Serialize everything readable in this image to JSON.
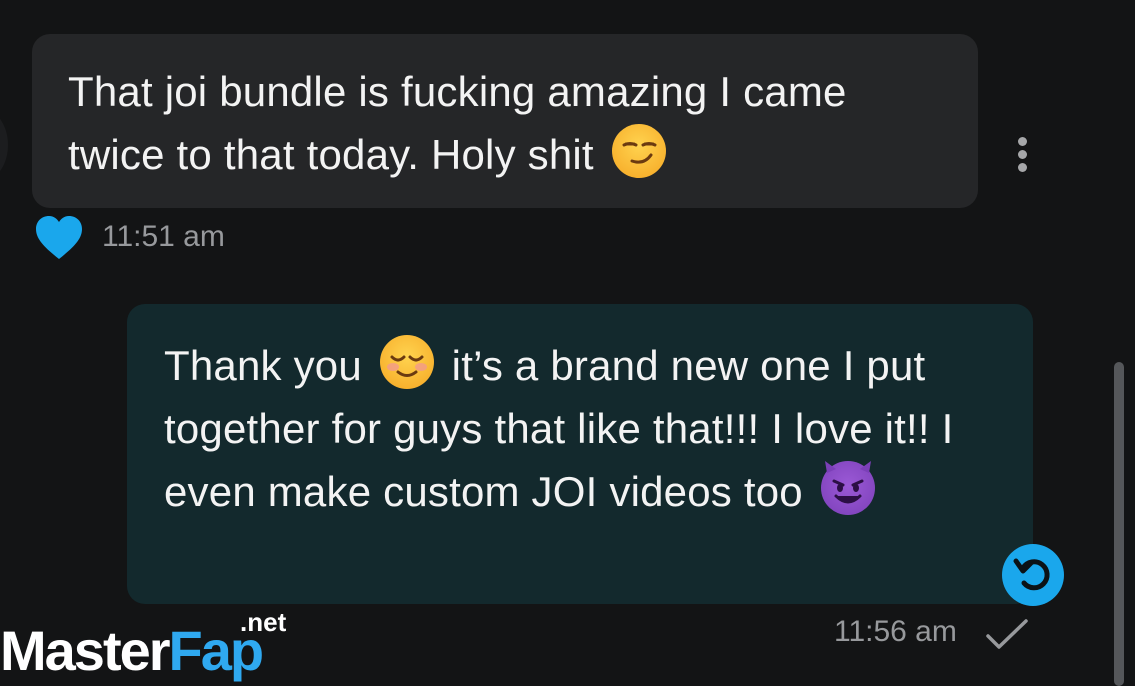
{
  "messages": [
    {
      "direction": "incoming",
      "text_before_emoji": "That joi bundle is fucking amazing I came twice to that today. Holy shit",
      "emoji": "smirking-face",
      "time": "11:51 am",
      "reaction": "heart"
    },
    {
      "direction": "outgoing",
      "text_part1": "Thank you",
      "emoji1": "smiling-face",
      "text_part2": "it’s a brand new one I put together for guys that like that!!! I love it!! I even make custom JOI videos too",
      "emoji2": "smiling-face-with-horns",
      "time": "11:56 am",
      "status": "sent"
    }
  ],
  "colors": {
    "background": "#131415",
    "incoming_bubble": "#252628",
    "outgoing_bubble": "#13292d",
    "accent": "#1aa7ec",
    "timestamp": "#97999c"
  },
  "watermark": {
    "part1": "Master",
    "part2": "Fap",
    "tld": ".net"
  }
}
